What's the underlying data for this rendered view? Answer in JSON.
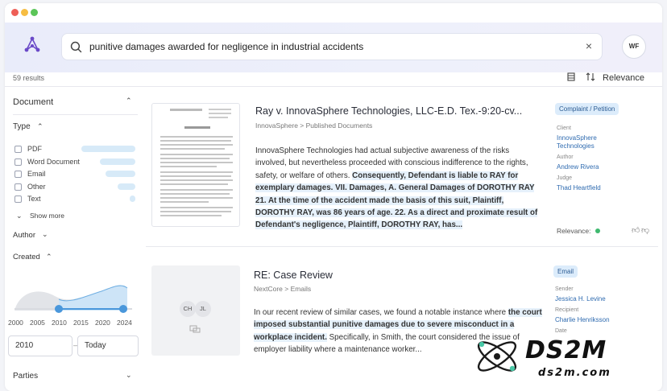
{
  "window": {
    "controls": {
      "close_color": "#ee5f57",
      "min_color": "#f6bd43",
      "max_color": "#5bc558"
    }
  },
  "search": {
    "query": "punitive damages awarded for negligence in industrial accidents",
    "clear_label": "×"
  },
  "user": {
    "initials": "WF"
  },
  "results": {
    "count_label": "59 results",
    "sort_label": "Relevance"
  },
  "sidebar": {
    "document_title": "Document",
    "type_title": "Type",
    "types": [
      {
        "label": "PDF",
        "fill": 0.9
      },
      {
        "label": "Word Document",
        "fill": 0.6
      },
      {
        "label": "Email",
        "fill": 0.5
      },
      {
        "label": "Other",
        "fill": 0.3
      },
      {
        "label": "Text",
        "fill": 0.1
      }
    ],
    "show_more": "Show more",
    "author_title": "Author",
    "created_title": "Created",
    "year_ticks": [
      "2000",
      "2005",
      "2010",
      "2015",
      "2020",
      "2024"
    ],
    "range_from": "2010",
    "range_to": "Today",
    "range_separator": "–",
    "parties_title": "Parties"
  },
  "results_list": [
    {
      "title": "Ray v. InnovaSphere Technologies, LLC-E.D. Tex.-9:20-cv...",
      "path": "InnovaSphere > Published Documents",
      "body_plain": "InnovaSphere Technologies had actual subjective awareness of the risks involved, but nevertheless proceeded with conscious indifference to the rights, safety, or welfare of others. ",
      "body_highlight": "Consequently, Defendant is liable to RAY for exemplary damages. VII. Damages, A. General Damages of DOROTHY RAY 21.  At the time of the accident made the basis of this suit, Plaintiff, DOROTHY RAY, was 86 years of age. 22. As a direct and proximate result of Defendant's negligence, Plaintiff, DOROTHY RAY, has...",
      "tag": "Complaint / Petition",
      "meta": [
        {
          "label": "Client",
          "value": "InnovaSphere Technologies"
        },
        {
          "label": "Author",
          "value": "Andrew Rivera"
        },
        {
          "label": "Judge",
          "value": "Thad Heartfield"
        }
      ],
      "relevance_label": "Relevance:"
    },
    {
      "title": "RE: Case Review",
      "path": "NextCore > Emails",
      "body_plain": "In our recent review of similar cases, we found a notable instance where ",
      "body_highlight": "the court imposed substantial punitive damages due to severe misconduct in a workplace incident.",
      "body_tail": " Specifically, in Smith, the court considered the issue of employer liability where a maintenance worker...",
      "tag": "Email",
      "avatars": [
        "CH",
        "JL"
      ],
      "meta": [
        {
          "label": "Sender",
          "value": "Jessica H. Levine"
        },
        {
          "label": "Recipient",
          "value": "Charlie Henriksson"
        },
        {
          "label": "Date",
          "value": ""
        }
      ]
    }
  ],
  "watermark": {
    "brand": "DS2M",
    "url": "ds2m.com"
  }
}
